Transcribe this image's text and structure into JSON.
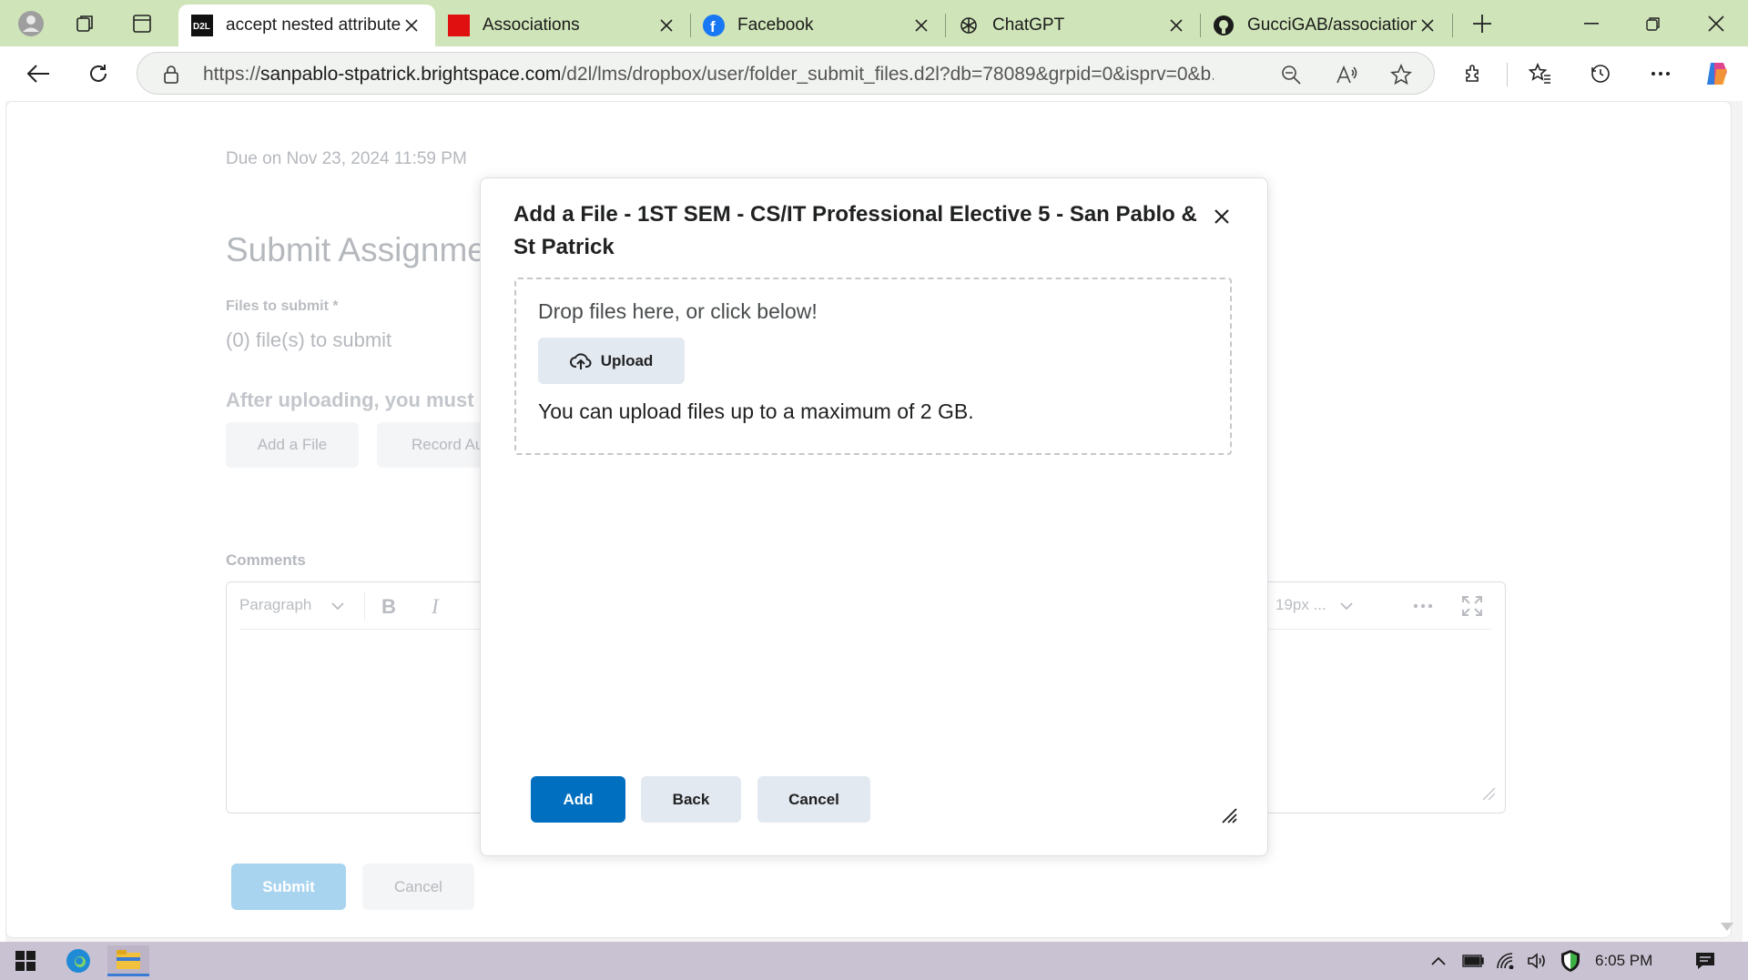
{
  "browser": {
    "tabs": [
      {
        "title": "accept nested attribute",
        "favicon": "d2l-icon",
        "active": true
      },
      {
        "title": "Associations",
        "favicon": "red-square-icon",
        "active": false
      },
      {
        "title": "Facebook",
        "favicon": "facebook-icon",
        "active": false
      },
      {
        "title": "ChatGPT",
        "favicon": "chatgpt-icon",
        "active": false
      },
      {
        "title": "GucciGAB/associations",
        "favicon": "github-icon",
        "active": false
      }
    ],
    "url_prefix": "https://",
    "url_host": "sanpablo-stpatrick.brightspace.com",
    "url_path": "/d2l/lms/dropbox/user/folder_submit_files.d2l?db=78089&grpid=0&isprv=0&b..."
  },
  "page": {
    "due": "Due on Nov 23, 2024 11:59 PM",
    "heading": "Submit Assignment",
    "files_label": "Files to submit *",
    "files_count": "(0) file(s) to submit",
    "after_uploading": "After uploading, you must c",
    "add_file_label": "Add a File",
    "record_audio_label": "Record Au",
    "comments_label": "Comments",
    "editor": {
      "format_label": "Paragraph",
      "font_size_label": "19px ..."
    },
    "submit_label": "Submit",
    "cancel_label": "Cancel"
  },
  "dialog": {
    "title": "Add a File - 1ST SEM - CS/IT Professional Elective 5 - San Pablo & St Patrick",
    "drop_text": "Drop files here, or click below!",
    "upload_label": "Upload",
    "max_text": "You can upload files up to a maximum of 2 GB.",
    "add_label": "Add",
    "back_label": "Back",
    "cancel_label": "Cancel"
  },
  "taskbar": {
    "clock": "6:05 PM"
  },
  "colors": {
    "tabstrip": "#cfe4b8",
    "primary_button": "#006fbf",
    "secondary_button": "#e3e9f1",
    "taskbar": "#c9c2d2"
  }
}
